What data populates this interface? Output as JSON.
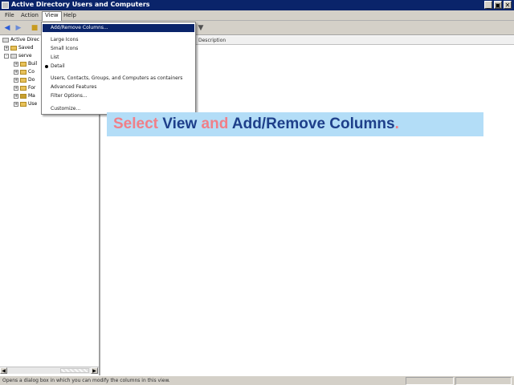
{
  "window": {
    "title": "Active Directory Users and Computers",
    "buttons": [
      "_",
      "▣",
      "✕"
    ]
  },
  "menu": {
    "items": [
      {
        "label": "File"
      },
      {
        "label": "Action"
      },
      {
        "label": "View"
      },
      {
        "label": "Help"
      }
    ]
  },
  "tree": {
    "items": [
      {
        "label": "Active Direc",
        "icon": "ad-icon"
      },
      {
        "label": "Saved",
        "icon": "folder-icon"
      },
      {
        "label": "serve",
        "icon": "domain-icon"
      },
      {
        "label": "Buil",
        "icon": "folder-icon"
      },
      {
        "label": "Co",
        "icon": "folder-icon"
      },
      {
        "label": "Do",
        "icon": "folder-icon"
      },
      {
        "label": "For",
        "icon": "folder-icon"
      },
      {
        "label": "Ma",
        "icon": "folder-icon"
      },
      {
        "label": "Use",
        "icon": "folder-icon"
      }
    ]
  },
  "list": {
    "columns": [
      "Description"
    ]
  },
  "view_menu": {
    "items": [
      {
        "label": "Add/Remove Columns..."
      },
      {
        "label": "Large Icons"
      },
      {
        "label": "Small Icons"
      },
      {
        "label": "List"
      },
      {
        "label": "Detail"
      },
      {
        "label": "Users, Contacts, Groups, and Computers as containers"
      },
      {
        "label": "Advanced Features"
      },
      {
        "label": "Filter Options..."
      },
      {
        "label": "Customize..."
      }
    ]
  },
  "status": {
    "text": "Opens a dialog box in which you can modify the columns in this view."
  },
  "callout": {
    "w1": "Select",
    "w2": "View",
    "w3": "and",
    "w4": "Add/Remove Columns",
    "w5": "."
  },
  "colors": {
    "titlebar": "#0a246a",
    "highlight": "#0a246a",
    "callout_bg": "#b3ddf7",
    "callout_pink": "#f07f88",
    "callout_blue": "#1e3f8a"
  }
}
